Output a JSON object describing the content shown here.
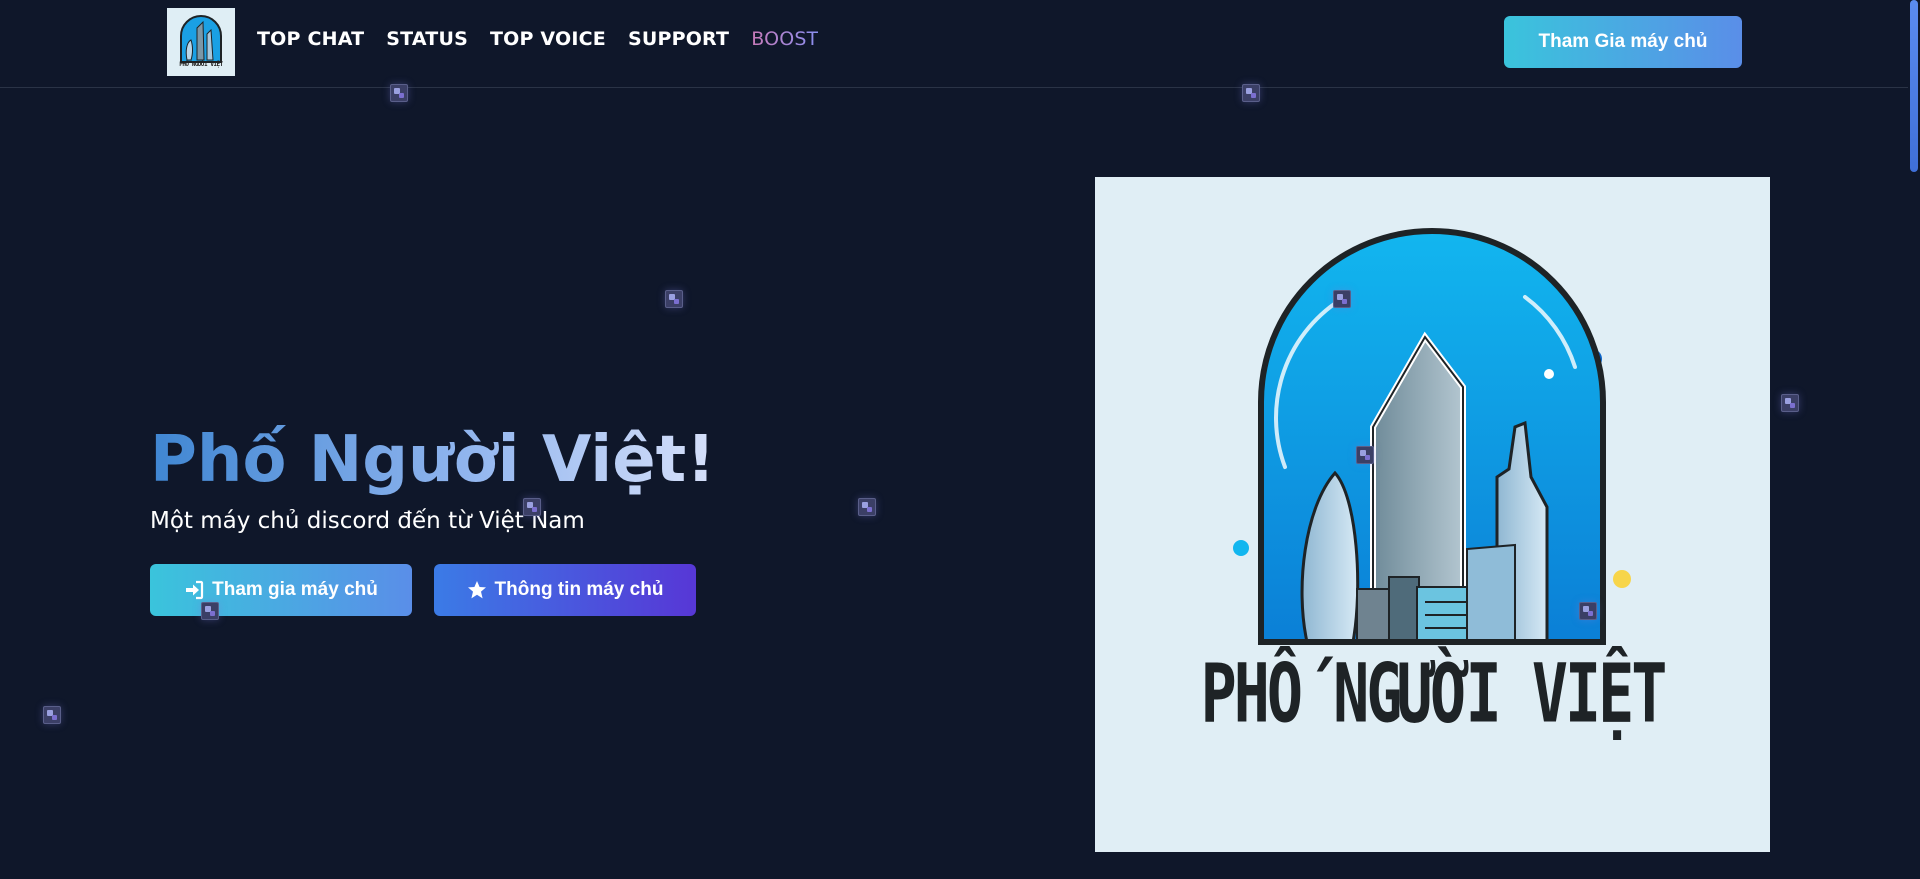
{
  "nav": {
    "brand_alt": "PHỐ NGƯỜI VIỆT",
    "links": [
      {
        "label": "TOP CHAT"
      },
      {
        "label": "STATUS"
      },
      {
        "label": "TOP VOICE"
      },
      {
        "label": "SUPPORT"
      },
      {
        "label": "BOOST"
      }
    ],
    "cta_label": "Tham Gia máy chủ"
  },
  "hero": {
    "title": "Phố Người Việt!",
    "subtitle": "Một máy chủ discord đến từ Việt Nam",
    "join_button": "Tham gia máy chủ",
    "info_button": "Thông tin máy chủ"
  },
  "logo": {
    "text": "PHỐ NGƯỜI VIỆT"
  },
  "colors": {
    "background": "#0f172a",
    "accent_cyan": "#3ac4dc",
    "accent_blue": "#5a8ee8",
    "accent_purple": "#5737d6",
    "logo_panel": "#e0eef5"
  },
  "icons": {
    "join": "sign-in-icon",
    "info": "star-icon",
    "decorations": "sparkle-icon"
  }
}
